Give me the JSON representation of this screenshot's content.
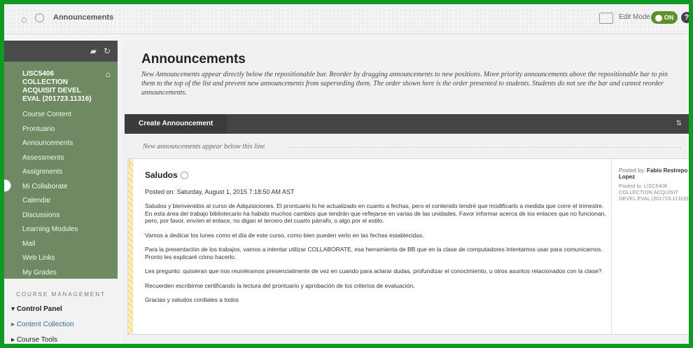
{
  "topbar": {
    "breadcrumb": "Announcements",
    "edit_mode_label": "Edit Mode is:",
    "edit_mode_state": "ON",
    "help_glyph": "?"
  },
  "sidebar": {
    "course_title": "LISC5406 COLLECTION ACQUISIT DEVEL EVAL (201723.11316)",
    "items": [
      {
        "label": "Course Content"
      },
      {
        "label": "Prontuario"
      },
      {
        "label": "Announcements"
      },
      {
        "label": "Assessments"
      },
      {
        "label": "Assignments"
      },
      {
        "label": "Mi Collaborate"
      },
      {
        "label": "Calendar"
      },
      {
        "label": "Discussions"
      },
      {
        "label": "Learning Modules"
      },
      {
        "label": "Mail"
      },
      {
        "label": "Web Links"
      },
      {
        "label": "My Grades"
      }
    ],
    "course_management_title": "COURSE MANAGEMENT",
    "control_panel": "Control Panel",
    "content_collection": "Content Collection",
    "course_tools": "Course Tools"
  },
  "main": {
    "title": "Announcements",
    "description": "New Announcements appear directly below the repositionable bar. Reorder by dragging announcements to new positions. Move priority announcements above the repositionable bar to pin them to the top of the list and prevent new announcements from superseding them. The order shown here is the order presented to students. Students do not see the bar and cannot reorder announcements.",
    "create_button": "Create Announcement",
    "new_line_text": "New announcements appear below this line"
  },
  "post": {
    "title": "Saludos",
    "posted_on": "Posted on: Saturday, August 1, 2015 7:18:50 AM AST",
    "paragraphs": [
      "Saludos y bienvenidos al curso de Adquisiciones. El prontuario lo he actualizado en cuanto a fechas, pero el contenido tendré que modificarlo a medida que corre el trimestre. En esta área del trabajo bibliotecario ha habido muchos cambios que tendrán que reflejarse en varias de las unidades. Favor informar acerca de los enlaces que no funcionan, pero, por favor, envíen el enlace, no digan el tercero del cuarto párrafo, o algo por el estilo.",
      "Vamos a dedicar los lunes como el día de este curso, como bien pueden verlo en las fechas establecidas.",
      "Para la presentación de los trabajos, vamos a intentar utilizar COLLABORATE, esa herramienta de BB que en la clase de computadores intentamos usar para comunicarnos. Pronto les explicaré cómo hacerlo.",
      "Les pregunto: quisieran que nos reuniéramos presencialmente de vez en cuando para aclarar dudas, profundizar el conocimiento, u otros asuntos relacionados con la clase?",
      "Recuerden escribirme certificando la lectura del prontuario y aprobación de los criterios de evaluación.",
      "Gracias y saludos cordiales a todos"
    ],
    "posted_by_label": "Posted by:",
    "posted_by_name": "Fabio Restrepo Lopez",
    "posted_to": "Posted to: LISC5406 COLLECTION ACQUISIT DEVEL EVAL (201723.11316)"
  }
}
